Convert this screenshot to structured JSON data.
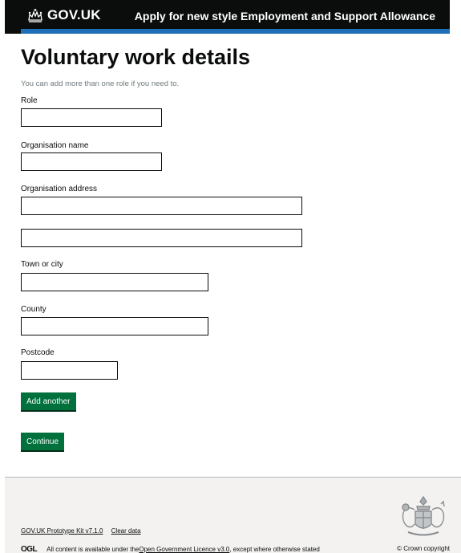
{
  "header": {
    "logo_text": "GOV.UK",
    "service_name": "Apply for new style Employment and Support Allowance",
    "brand_color": "#0b0c0c",
    "accent_color": "#1d70b8"
  },
  "main": {
    "title": "Voluntary work details",
    "hint": "You can add more than one role if you need to.",
    "fields": {
      "role": {
        "label": "Role",
        "value": ""
      },
      "organisation_name": {
        "label": "Organisation name",
        "value": ""
      },
      "organisation_address": {
        "label": "Organisation address",
        "line1": "",
        "line2": ""
      },
      "town": {
        "label": "Town or city",
        "value": ""
      },
      "county": {
        "label": "County",
        "value": ""
      },
      "postcode": {
        "label": "Postcode",
        "value": ""
      }
    },
    "add_another_label": "Add another",
    "continue_label": "Continue",
    "button_color": "#00703c"
  },
  "footer": {
    "prototype_kit_link": "GOV.UK Prototype Kit v7.1.0",
    "clear_data_link": "Clear data",
    "ogl_logo": "OGL",
    "licence_prefix": "All content is available under the ",
    "licence_link": "Open Government Licence v3.0",
    "licence_suffix": ", except where otherwise stated",
    "copyright": "© Crown copyright",
    "crest_icon": "royal-coat-of-arms-icon"
  }
}
